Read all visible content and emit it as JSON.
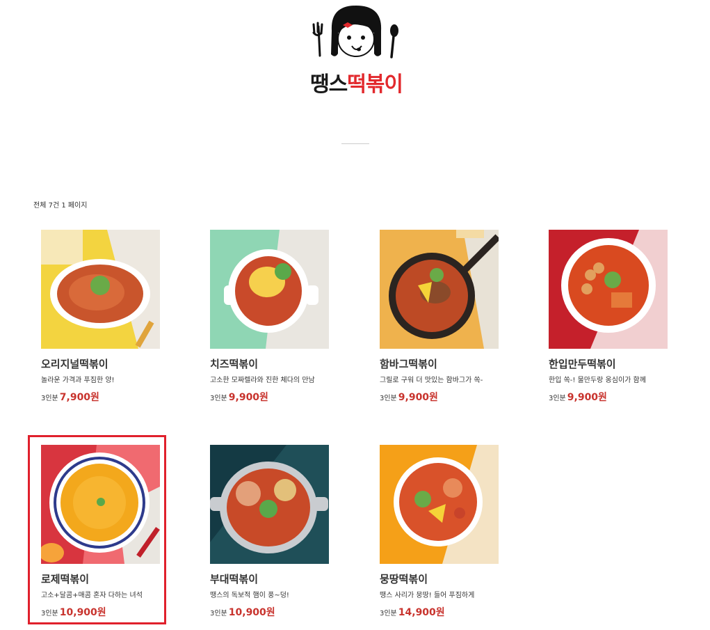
{
  "brand": {
    "name_part1": "땡스",
    "name_part2": "떡볶이"
  },
  "list": {
    "count_text": "전체 7건 1 페이지"
  },
  "products": [
    {
      "name": "오리지널떡볶이",
      "desc": "놀라운 가격과 푸짐한 양!",
      "unit": "3인분",
      "price": "7,900원",
      "selected": false
    },
    {
      "name": "치즈떡볶이",
      "desc": "고소한 모짜렐라와 진한 체다의 만남",
      "unit": "3인분",
      "price": "9,900원",
      "selected": false
    },
    {
      "name": "함바그떡볶이",
      "desc": "그릴로 구워 더 맛있는 함바그가 쏙-",
      "unit": "3인분",
      "price": "9,900원",
      "selected": false
    },
    {
      "name": "한입만두떡볶이",
      "desc": "한입 쏙-! 물만두랑 옹심이가 함께",
      "unit": "3인분",
      "price": "9,900원",
      "selected": false
    },
    {
      "name": "로제떡볶이",
      "desc": "고소+달콤+매콤 혼자 다하는 녀석",
      "unit": "3인분",
      "price": "10,900원",
      "selected": true
    },
    {
      "name": "부대떡볶이",
      "desc": "땡스의 독보적 햄이 풍~덩!",
      "unit": "3인분",
      "price": "10,900원",
      "selected": false
    },
    {
      "name": "뭉땅떡볶이",
      "desc": "땡스 사리가 뭉땅! 들어 푸짐하게",
      "unit": "3인분",
      "price": "14,900원",
      "selected": false
    }
  ],
  "colors": {
    "accent": "#c8332d",
    "highlight": "#e0202c"
  }
}
